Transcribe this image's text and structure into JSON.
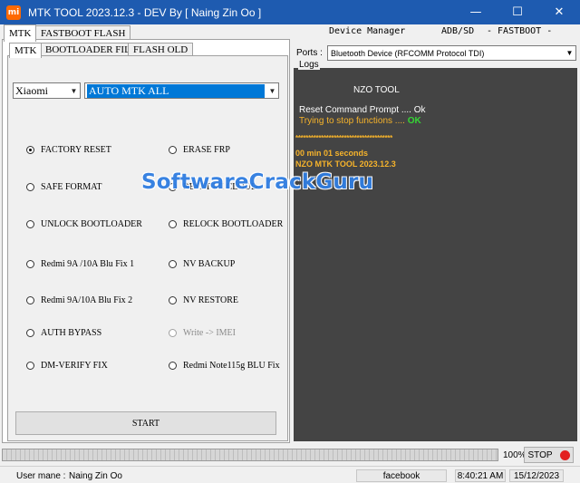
{
  "window": {
    "icon_text": "mi",
    "title": "MTK TOOL 2023.12.3 - DEV By [ Naing Zin Oo ]",
    "minimize": "—",
    "maximize": "☐",
    "close": "✕"
  },
  "outer_tabs": [
    {
      "label": "MTK",
      "active": true
    },
    {
      "label": "FASTBOOT FLASH",
      "active": false
    }
  ],
  "inner_tabs": [
    {
      "label": "MTK",
      "active": true
    },
    {
      "label": "BOOTLOADER FILE",
      "active": false
    },
    {
      "label": "FLASH OLD",
      "active": false
    }
  ],
  "brand_select": {
    "value": "Xiaomi"
  },
  "mode_select": {
    "value": "AUTO MTK ALL"
  },
  "options_left": [
    {
      "label": "FACTORY RESET",
      "checked": true
    },
    {
      "label": "SAFE FORMAT",
      "checked": false
    },
    {
      "label": "UNLOCK BOOTLOADER",
      "checked": false
    },
    {
      "label": "Redmi 9A /10A Blu Fix 1",
      "checked": false
    },
    {
      "label": "Redmi  9A/10A Blu Fix 2",
      "checked": false
    },
    {
      "label": "AUTH BYPASS",
      "checked": false
    },
    {
      "label": "DM-VERIFY FIX",
      "checked": false
    }
  ],
  "options_right": [
    {
      "label": "ERASE FRP",
      "checked": false,
      "disabled": false
    },
    {
      "label": "RESET MI CLOUD",
      "checked": false,
      "disabled": false
    },
    {
      "label": "RELOCK BOOTLOADER",
      "checked": false,
      "disabled": false
    },
    {
      "label": "NV BACKUP",
      "checked": false,
      "disabled": false
    },
    {
      "label": "NV RESTORE",
      "checked": false,
      "disabled": false
    },
    {
      "label": "Write -> IMEI",
      "checked": false,
      "disabled": true
    },
    {
      "label": "Redmi Note115g BLU Fix",
      "checked": false,
      "disabled": false
    }
  ],
  "start_label": "START",
  "menu": {
    "device_manager": "Device Manager",
    "adb_sd": "ADB/SD",
    "fastboot": "- FASTBOOT -"
  },
  "ports": {
    "label": "Ports :",
    "value": "Bluetooth Device (RFCOMM Protocol TDI)"
  },
  "logs": {
    "label": "Logs",
    "lines": [
      {
        "text": "NZO TOOL",
        "color": "#ffffff",
        "bold": false
      },
      {
        "text": "Reset Command Prompt .... Ok",
        "color": "#ffffff",
        "bold": false
      },
      {
        "text": "Trying to stop functions .... ",
        "color": "#f6b32b",
        "bold": false,
        "suffix": "OK",
        "suffix_color": "#35d635"
      },
      {
        "text": "**************************************",
        "color": "#f6b32b",
        "bold": true
      },
      {
        "text": "00 min 01 seconds",
        "color": "#f6b32b",
        "bold": true
      },
      {
        "text": "NZO MTK TOOL 2023.12.3",
        "color": "#f6b32b",
        "bold": true
      }
    ]
  },
  "progress": {
    "percent_label": "100%",
    "value": 100
  },
  "stop_label": "STOP",
  "status": {
    "user_label": "User mane :",
    "user_name": "Naing Zin Oo",
    "facebook": "facebook",
    "time": "8:40:21 AM",
    "date": "15/12/2023"
  },
  "watermark": "SoftwareCrackGuru",
  "colors": {
    "titlebar": "#1e5bb0",
    "log_bg": "#444444",
    "log_orange": "#f6b32b",
    "log_ok_green": "#35d635",
    "stop_red": "#e32020"
  }
}
